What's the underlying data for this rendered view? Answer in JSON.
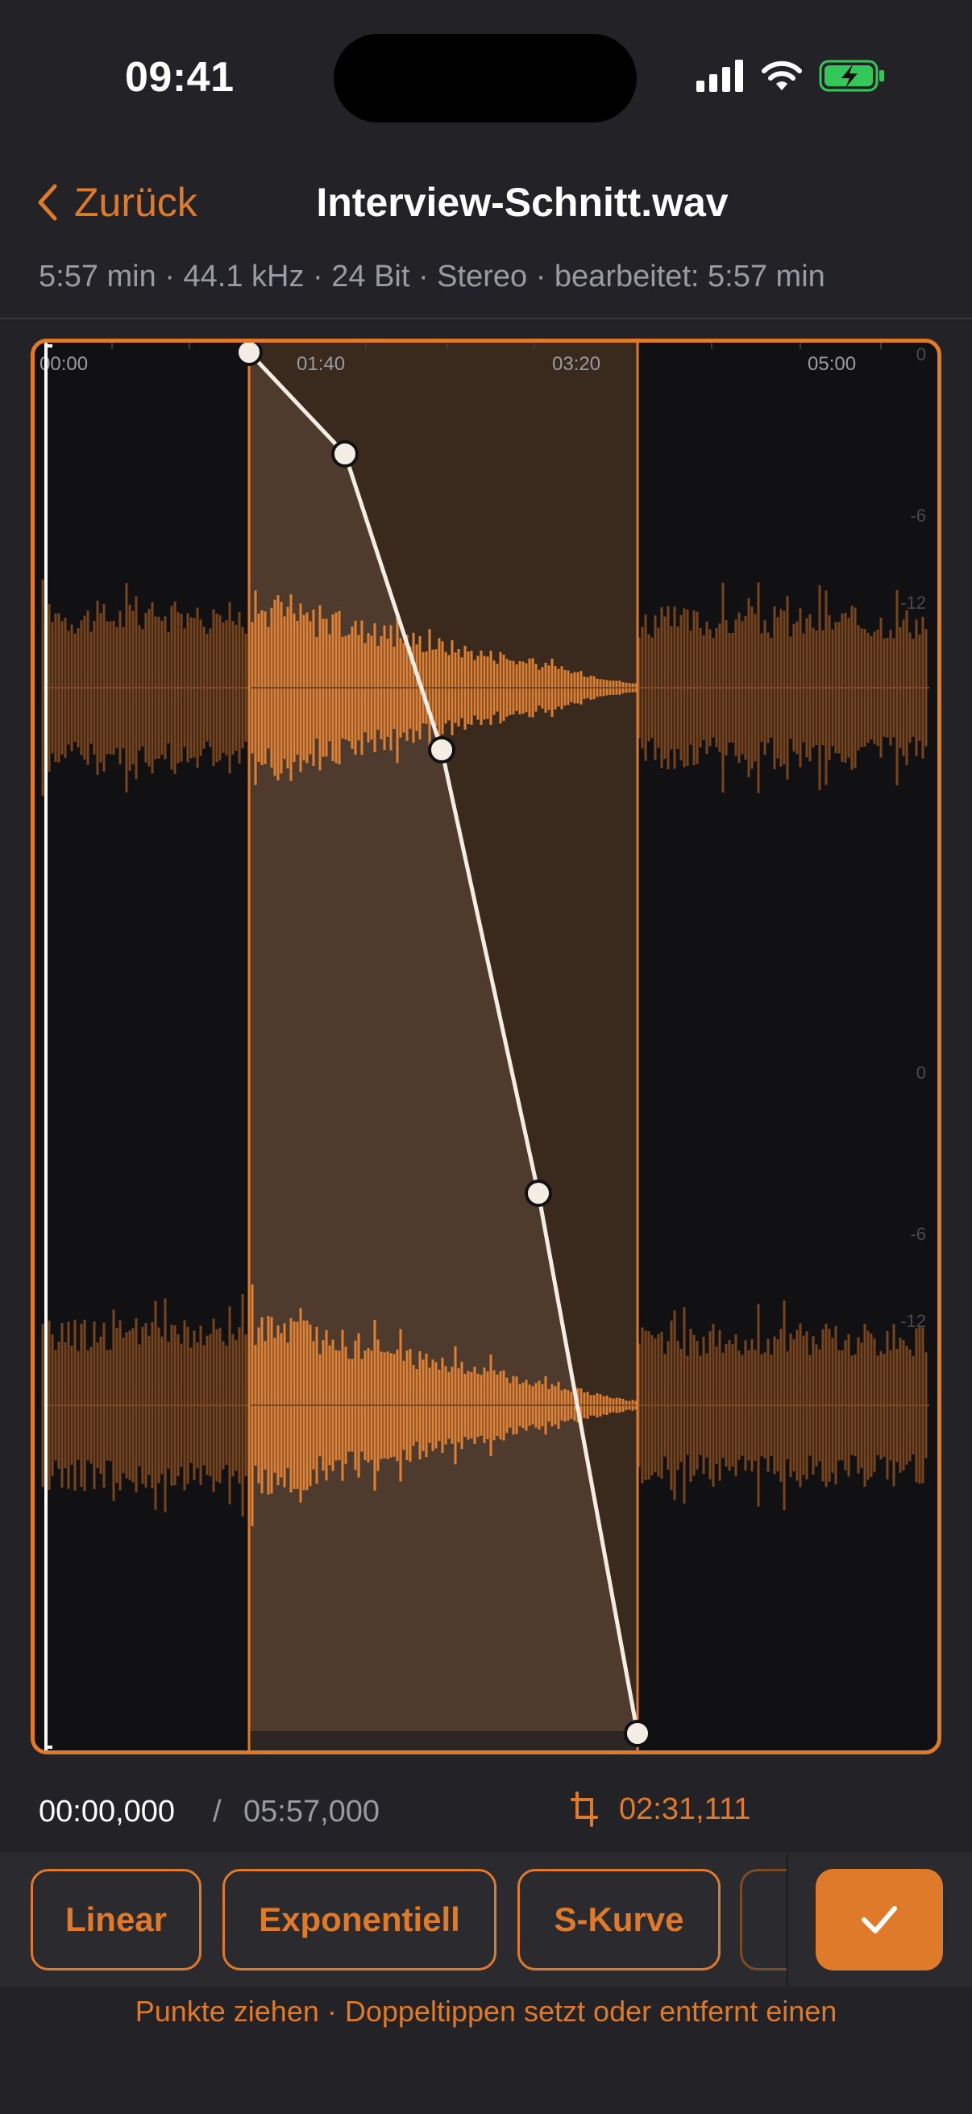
{
  "status_bar": {
    "time": "09:41"
  },
  "nav": {
    "back_label": "Zurück",
    "title": "Interview-Schnitt.wav"
  },
  "meta_line": "5:57 min · 44.1 kHz · 24 Bit · Stereo · bearbeitet: 5:57 min",
  "timeline": {
    "ticks": [
      "00:00",
      "01:40",
      "03:20",
      "05:00"
    ],
    "db_labels_top": [
      "0",
      "-6",
      "-12"
    ],
    "db_labels_bottom": [
      "0",
      "-6",
      "-12"
    ]
  },
  "playback": {
    "current": "00:00,000",
    "separator": "/",
    "total": "05:57,000",
    "selection_length": "02:31,111"
  },
  "toolbar": {
    "presets": [
      "Linear",
      "Exponentiell",
      "S-Kurve"
    ],
    "confirm_icon": "checkmark-icon"
  },
  "hint": "Punkte ziehen · Doppeltippen setzt oder entfernt einen",
  "colors": {
    "accent": "#E07A2B",
    "background": "#232327",
    "editor_bg": "#111114"
  }
}
